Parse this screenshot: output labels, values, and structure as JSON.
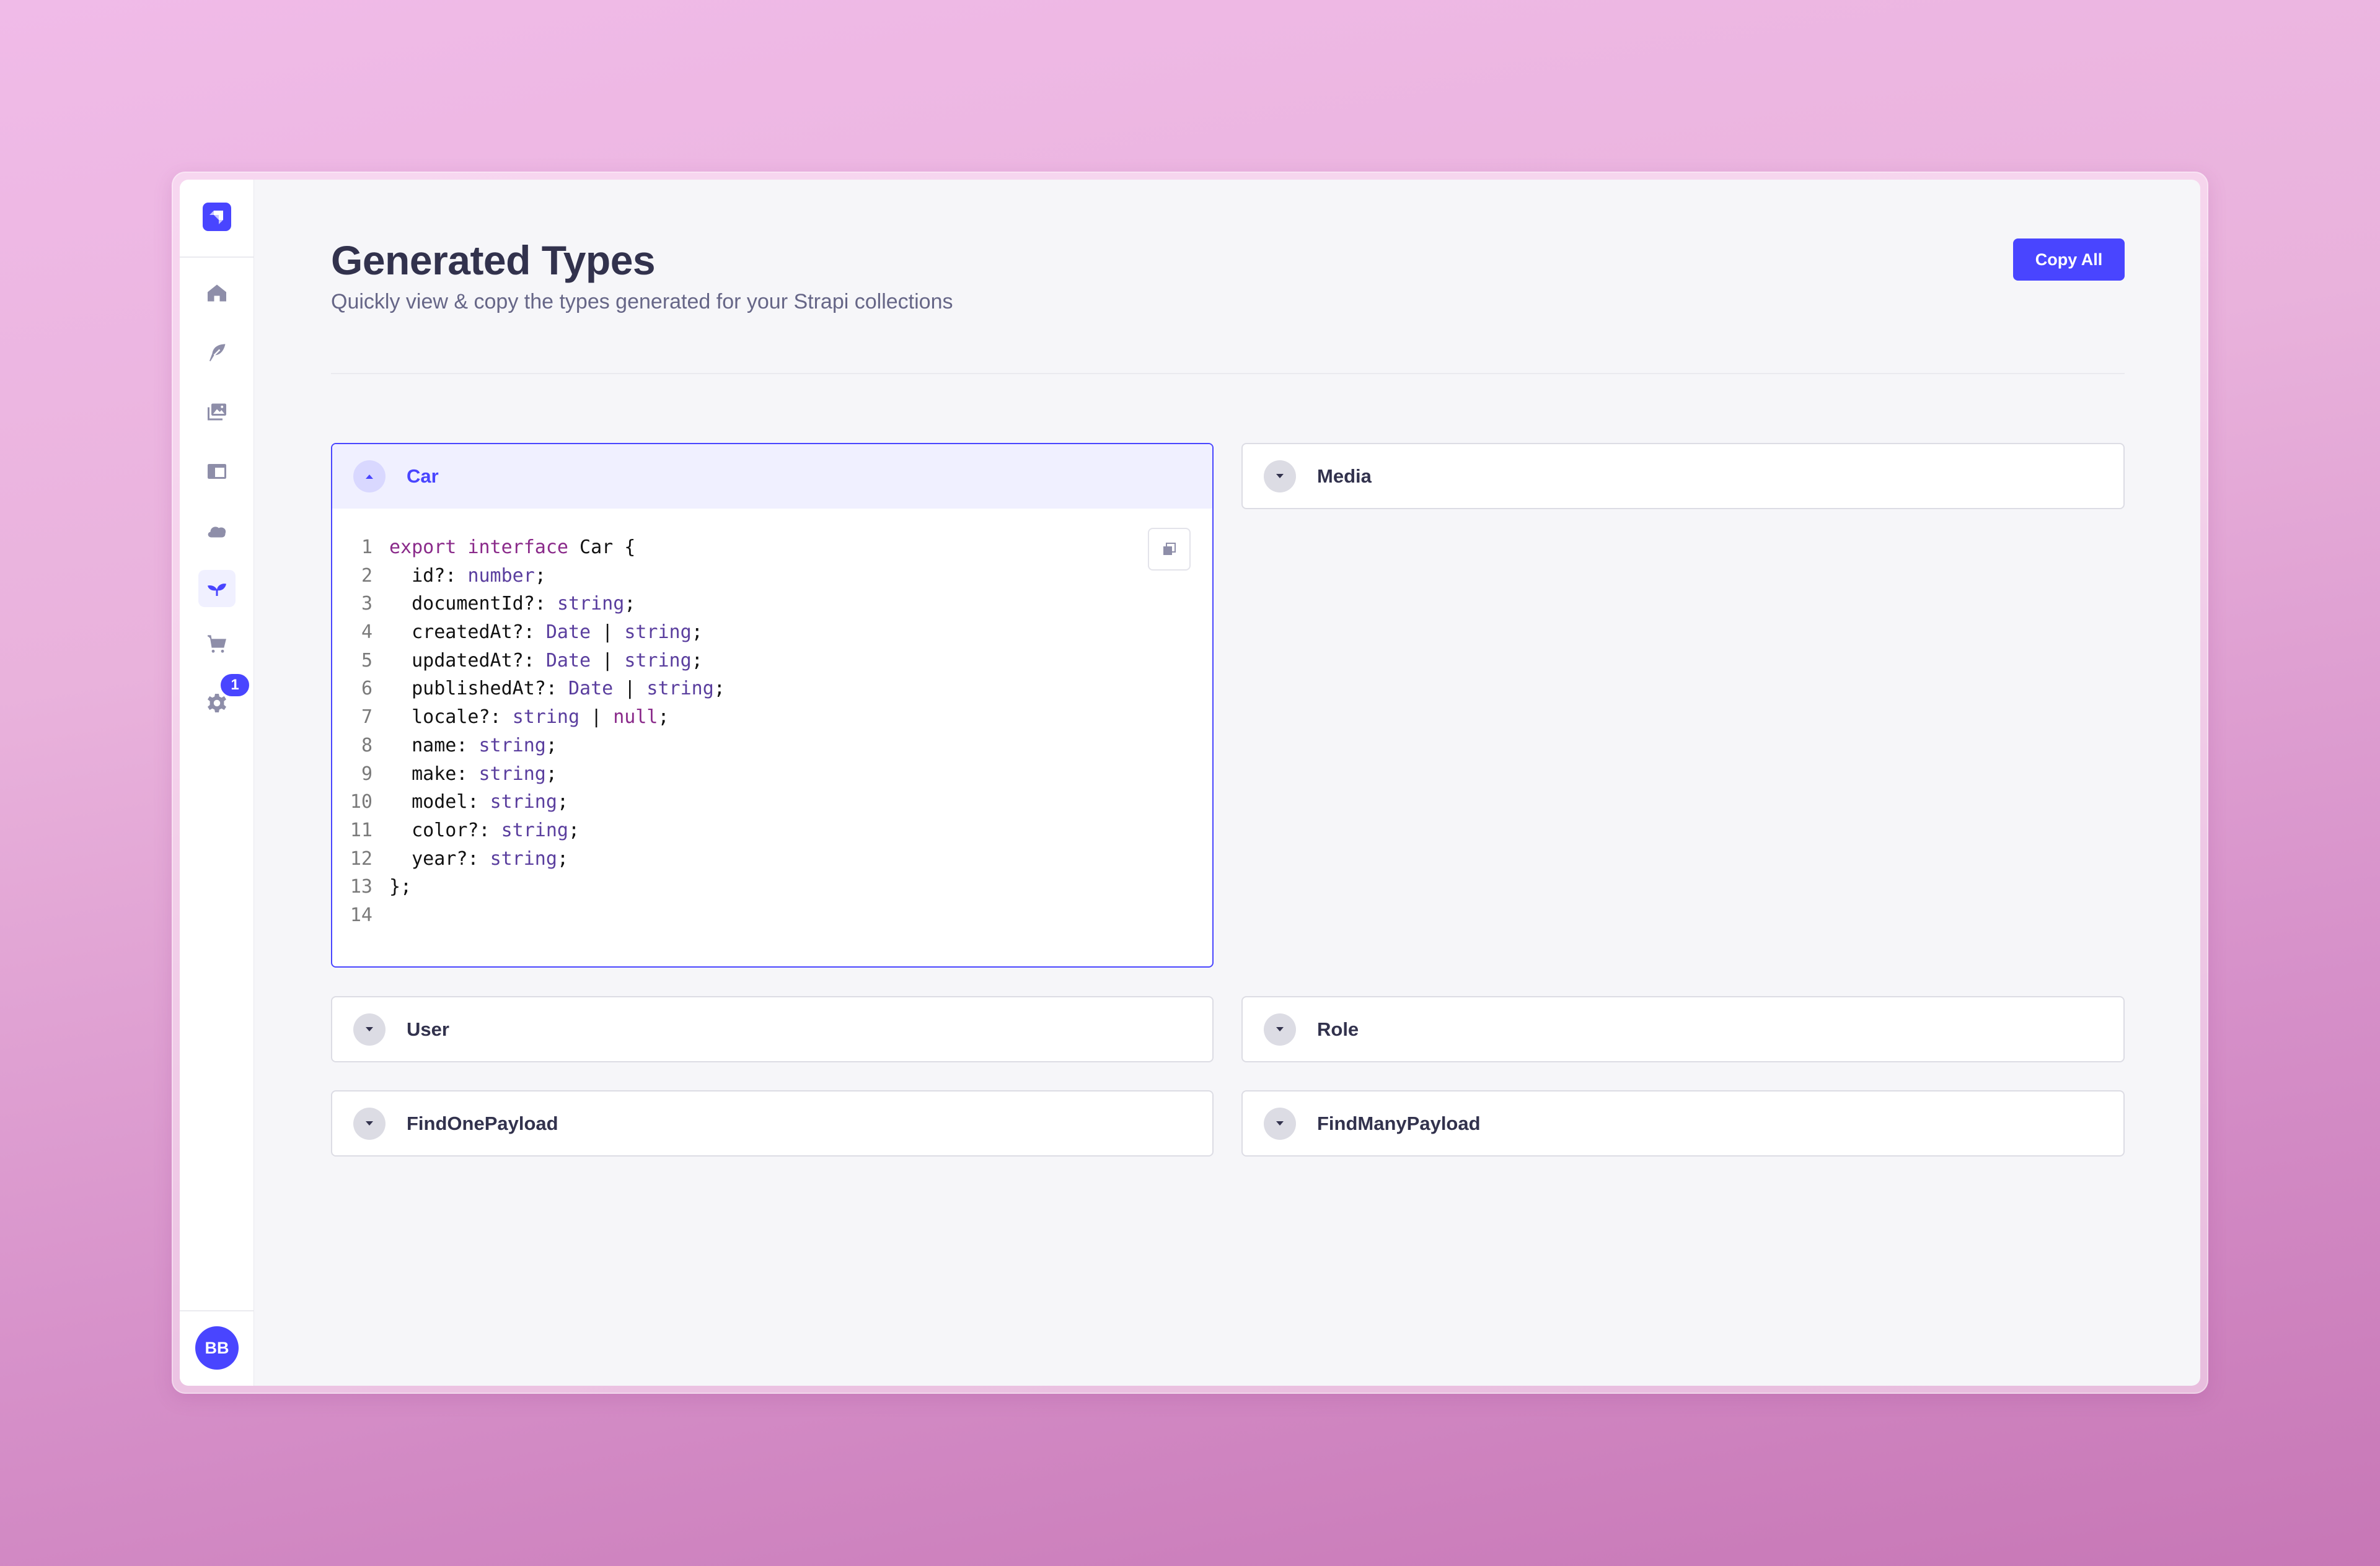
{
  "sidebar": {
    "logo": "strapi-logo",
    "items": [
      {
        "name": "home",
        "icon": "house-icon",
        "active": false
      },
      {
        "name": "content-manager",
        "icon": "feather-icon",
        "active": false
      },
      {
        "name": "media-library",
        "icon": "images-icon",
        "active": false
      },
      {
        "name": "content-type-builder",
        "icon": "layout-icon",
        "active": false
      },
      {
        "name": "deployment",
        "icon": "cloud-icon",
        "active": false
      },
      {
        "name": "generated-types-plugin",
        "icon": "seedling-icon",
        "active": true
      },
      {
        "name": "marketplace",
        "icon": "cart-icon",
        "active": false
      },
      {
        "name": "settings",
        "icon": "gear-icon",
        "active": false,
        "badge": "1"
      }
    ],
    "user_initials": "BB"
  },
  "header": {
    "title": "Generated Types",
    "subtitle": "Quickly view & copy the types generated for your Strapi collections",
    "copy_all_label": "Copy All"
  },
  "colors": {
    "primary": "#4945ff",
    "heading": "#32324d",
    "muted": "#666687",
    "keyword": "#8a2a8a",
    "type": "#5a3e9e"
  },
  "types": [
    {
      "name": "Car",
      "expanded": true
    },
    {
      "name": "Media",
      "expanded": false
    },
    {
      "name": "User",
      "expanded": false
    },
    {
      "name": "Role",
      "expanded": false
    },
    {
      "name": "FindOnePayload",
      "expanded": false
    },
    {
      "name": "FindManyPayload",
      "expanded": false
    }
  ],
  "code": {
    "lines": [
      [
        [
          "kw",
          "export"
        ],
        [
          "p",
          " "
        ],
        [
          "kw",
          "interface"
        ],
        [
          "p",
          " Car {"
        ]
      ],
      [
        [
          "p",
          "  id?: "
        ],
        [
          "type",
          "number"
        ],
        [
          "p",
          ";"
        ]
      ],
      [
        [
          "p",
          "  documentId?: "
        ],
        [
          "type",
          "string"
        ],
        [
          "p",
          ";"
        ]
      ],
      [
        [
          "p",
          "  createdAt?: "
        ],
        [
          "type",
          "Date"
        ],
        [
          "p",
          " | "
        ],
        [
          "type",
          "string"
        ],
        [
          "p",
          ";"
        ]
      ],
      [
        [
          "p",
          "  updatedAt?: "
        ],
        [
          "type",
          "Date"
        ],
        [
          "p",
          " | "
        ],
        [
          "type",
          "string"
        ],
        [
          "p",
          ";"
        ]
      ],
      [
        [
          "p",
          "  publishedAt?: "
        ],
        [
          "type",
          "Date"
        ],
        [
          "p",
          " | "
        ],
        [
          "type",
          "string"
        ],
        [
          "p",
          ";"
        ]
      ],
      [
        [
          "p",
          "  locale?: "
        ],
        [
          "type",
          "string"
        ],
        [
          "p",
          " | "
        ],
        [
          "null",
          "null"
        ],
        [
          "p",
          ";"
        ]
      ],
      [
        [
          "p",
          "  name: "
        ],
        [
          "type",
          "string"
        ],
        [
          "p",
          ";"
        ]
      ],
      [
        [
          "p",
          "  make: "
        ],
        [
          "type",
          "string"
        ],
        [
          "p",
          ";"
        ]
      ],
      [
        [
          "p",
          "  model: "
        ],
        [
          "type",
          "string"
        ],
        [
          "p",
          ";"
        ]
      ],
      [
        [
          "p",
          "  color?: "
        ],
        [
          "type",
          "string"
        ],
        [
          "p",
          ";"
        ]
      ],
      [
        [
          "p",
          "  year?: "
        ],
        [
          "type",
          "string"
        ],
        [
          "p",
          ";"
        ]
      ],
      [
        [
          "p",
          "};"
        ]
      ],
      [
        [
          "p",
          ""
        ]
      ]
    ]
  }
}
